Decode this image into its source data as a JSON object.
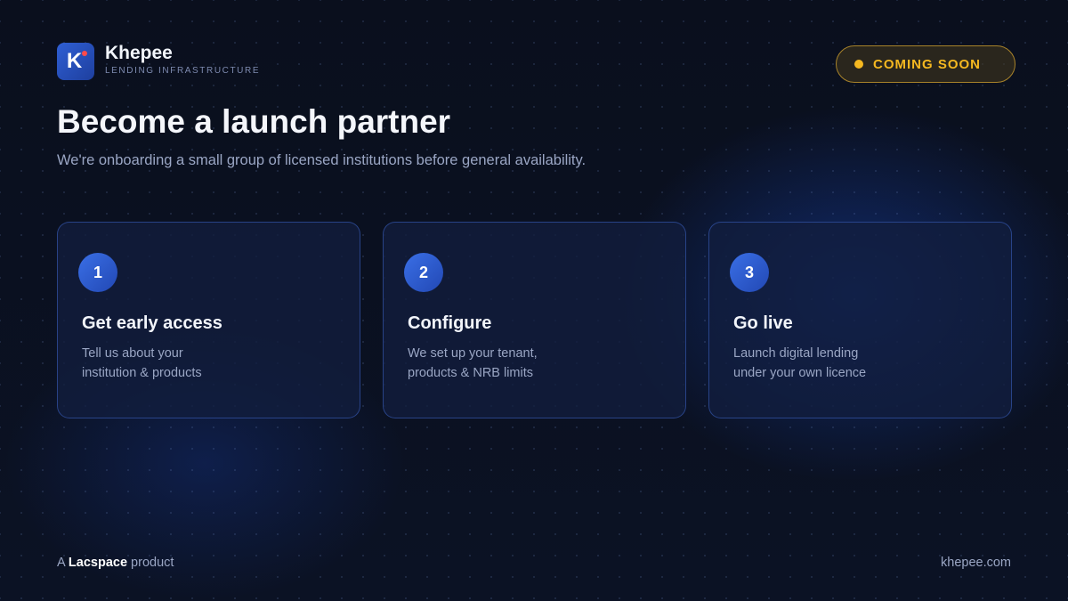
{
  "brand": {
    "logo_letter": "K",
    "name": "Khepee",
    "tagline": "LENDING INFRASTRUCTURE"
  },
  "badge": {
    "label": "COMING SOON"
  },
  "hero": {
    "title": "Become a launch partner",
    "subtitle": "We're onboarding a small group of licensed institutions before general availability."
  },
  "steps": [
    {
      "number": "1",
      "title": "Get early access",
      "line1": "Tell us about your",
      "line2": "institution & products"
    },
    {
      "number": "2",
      "title": "Configure",
      "line1": "We set up your tenant,",
      "line2": "products & NRB limits"
    },
    {
      "number": "3",
      "title": "Go live",
      "line1": "Launch digital lending",
      "line2": "under your own licence"
    }
  ],
  "footer": {
    "prefix": "A",
    "company": "Lacspace",
    "suffix": "product",
    "website": "khepee.com"
  },
  "colors": {
    "background": "#0a1020",
    "accent_blue": "#2f5fd4",
    "badge_yellow": "#f5b820",
    "logo_dot_red": "#ff4a4a"
  }
}
